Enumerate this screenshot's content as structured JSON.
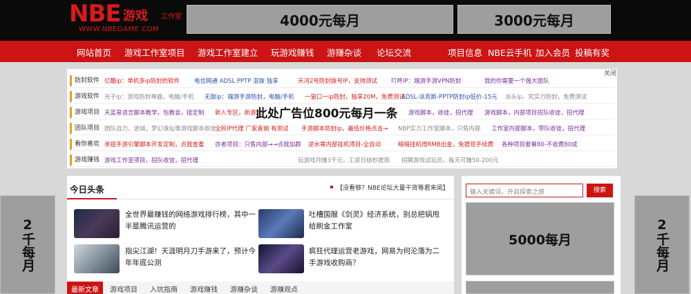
{
  "header": {
    "logo_main": "NBE",
    "logo_cn": "游戏",
    "logo_tag": "工作室",
    "logo_url": "WWW.NBEGAME.COM",
    "ad_top_1": "4000元每月",
    "ad_top_2": "3000元每月"
  },
  "nav": {
    "left": [
      "网站首页",
      "游戏工作室项目",
      "游戏工作室建立",
      "玩游戏赚钱",
      "游赚杂谈",
      "论坛交流"
    ],
    "right": [
      "项目信息",
      "NBE云手机",
      "加入会员",
      "投稿有奖"
    ]
  },
  "panel": {
    "close": "关闭",
    "overlay_ad": "此处广告位800元每月一条",
    "rows": [
      {
        "cat": "防封软件",
        "items": [
          {
            "text": "亿酷ip：单机多ip防封的软件",
            "color": "red"
          },
          {
            "text": "电信网通 ADSL PPTP 混拨 独享",
            "color": "blue"
          },
          {
            "text": "天河2号防封拨号IP，支持测试",
            "color": "red"
          },
          {
            "text": "叮咚IP：端游手游VPN防封",
            "color": "purple"
          },
          {
            "text": "我的你需要一个强大团队",
            "color": "purple"
          }
        ]
      },
      {
        "cat": "游戏软件",
        "items": [
          {
            "text": "光子ip：游戏防封神器，电脑/手机",
            "color": "gray"
          },
          {
            "text": "无敌ip：端游手游防封，电脑/手机",
            "color": "blue"
          },
          {
            "text": "一窗口一ip防封，独享20M，免费测试",
            "color": "red"
          },
          {
            "text": "ADSL-派克斯-PPTP防封ip低价-15元",
            "color": "blue"
          },
          {
            "text": "派头ip，究实力防封，免费测试",
            "color": "gray"
          }
        ]
      },
      {
        "cat": "游戏项目",
        "items": [
          {
            "text": "天蓝易语言脚本教学，包教会，接定制",
            "color": "purple"
          },
          {
            "text": "新人专区，新游戏",
            "color": "red"
          },
          {
            "text": "游戏脚本，收徒，招代理",
            "color": "purple"
          },
          {
            "text": "游戏脚本，内部项目招队收徒，招代理",
            "color": "purple"
          }
        ]
      },
      {
        "cat": "团队项目",
        "items": [
          {
            "text": "团队战力，迷城，梦幻诛仙等游戏脚本收徒",
            "color": "gray"
          },
          {
            "text": "全民IP代理 厂家直销 有测试",
            "color": "red"
          },
          {
            "text": "手游脚本防封ip，最低价格点击→",
            "color": "red"
          },
          {
            "text": "NBP实力工作室脚本，只售内部",
            "color": "gray"
          },
          {
            "text": "工作室内部脚本，带队收徒，招代理",
            "color": "purple"
          }
        ]
      },
      {
        "cat": "看你喜欢",
        "items": [
          {
            "text": "承接手游引擎脚本开发定制，点我查看",
            "color": "red"
          },
          {
            "text": "亦者项目：只售内部→→点我加群",
            "color": "purple"
          },
          {
            "text": "逆水寒内部挂机项目-全自动",
            "color": "red"
          },
          {
            "text": "暗暗挂机得RMB出金，免提现手续费",
            "color": "red"
          },
          {
            "text": "各种项目套餐80-不收费80成",
            "color": "purple"
          }
        ]
      },
      {
        "cat": "游戏赚钱",
        "items": [
          {
            "text": "游戏工作室项目，招队收徒，招代理",
            "color": "purple"
          },
          {
            "text": "玩游戏月赚3千元，工资日结秒提现",
            "color": "gray"
          },
          {
            "text": "招聘游戏试玩员，每天可赚50-200元",
            "color": "gray"
          }
        ]
      }
    ]
  },
  "side_ads": {
    "left": "2千每月",
    "right": "2千每月"
  },
  "news": {
    "title": "今日头条",
    "ticker": "【没看够？NBE论坛大量干货等君来阅】",
    "items": [
      {
        "text": "全世界最赚钱的网络游戏排行榜，其中一半是腾讯运营的"
      },
      {
        "text": "吐槽国服《剑灵》经济系统，别总把锅甩给刷金工作室"
      },
      {
        "text": "指尖江湖！天涯明月刀手游来了，预计今年年底公测"
      },
      {
        "text": "疯狂代理运营老游戏，网易为何沦落为二手游戏收购商？"
      }
    ],
    "tabs": [
      "最新文章",
      "游戏项目",
      "入坑指南",
      "游戏赚钱",
      "游赚杂谈",
      "游赚观点"
    ]
  },
  "search": {
    "placeholder": "输入关键词，开启探索之旅",
    "button": "搜索"
  },
  "right_ad": "5000每月"
}
